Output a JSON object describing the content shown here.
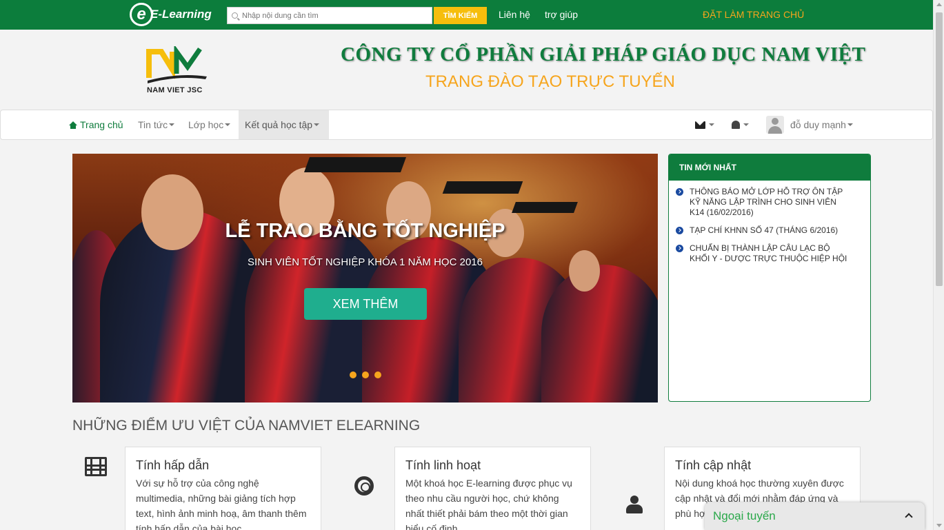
{
  "topbar": {
    "logo_text": "E-Learning",
    "search_placeholder": "Nhập nội dung cần tìm",
    "search_button": "TÌM KIẾM",
    "contact": "Liên hệ",
    "help": "trợ giúp",
    "set_homepage": "ĐẶT LÀM TRANG CHỦ"
  },
  "header": {
    "logo_text": "NAM VIET JSC",
    "company": "CÔNG TY CỔ PHẦN GIẢI PHÁP GIÁO DỤC NAM VIỆT",
    "subtitle": "TRANG ĐÀO TẠO TRỰC TUYẾN"
  },
  "nav": {
    "home": "Trang chủ",
    "news": "Tin tức",
    "classes": "Lớp học",
    "results": "Kết quả học tập",
    "user": "đỗ duy mạnh"
  },
  "slider": {
    "title": "LỄ TRAO BẰNG TỐT NGHIỆP",
    "caption": "SINH VIÊN TỐT NGHIỆP KHÓA 1 NĂM HỌC 2016",
    "button": "XEM THÊM"
  },
  "news": {
    "heading": "TIN MỚI NHẤT",
    "items": [
      "THÔNG BÁO MỞ LỚP HỖ TRỢ ÔN TẬP KỸ NĂNG LẬP TRÌNH CHO SINH VIÊN K14 (16/02/2016)",
      "TẠP CHÍ KHNN SỐ 47 (THÁNG 6/2016)",
      "CHUẨN BỊ THÀNH LẬP CÂU LẠC BỘ KHỐI Y - DƯỢC TRỰC THUỘC HIỆP HỘI"
    ]
  },
  "features": {
    "section_title": "NHỮNG ĐIỂM ƯU VIỆT CỦA NAMVIET ELEARNING",
    "items": [
      {
        "icon": "film-icon",
        "title": "Tính hấp dẫn",
        "text": "Với sự hỗ trợ của công nghệ multimedia, những bài giảng tích hợp text, hình ảnh minh hoạ, âm thanh thêm tính hấp dẫn của bài học"
      },
      {
        "icon": "life-ring-icon",
        "title": "Tính linh hoạt",
        "text": "Một khoá học E-learning được phục vụ theo nhu cầu người học, chứ không nhất thiết phải bám theo một thời gian biểu cố định"
      },
      {
        "icon": "user-icon",
        "title": "Tính cập nhật",
        "text": "Nội dung khoá học thường xuyên được cập nhật và đổi mới nhằm đáp ứng và phù hợp"
      }
    ]
  },
  "chat": {
    "label": "Ngoại tuyến"
  },
  "colors": {
    "brand_green": "#0c7d3c",
    "accent_orange": "#f6a51d",
    "button_teal": "#1fae8e",
    "search_yellow": "#f6be0c"
  }
}
